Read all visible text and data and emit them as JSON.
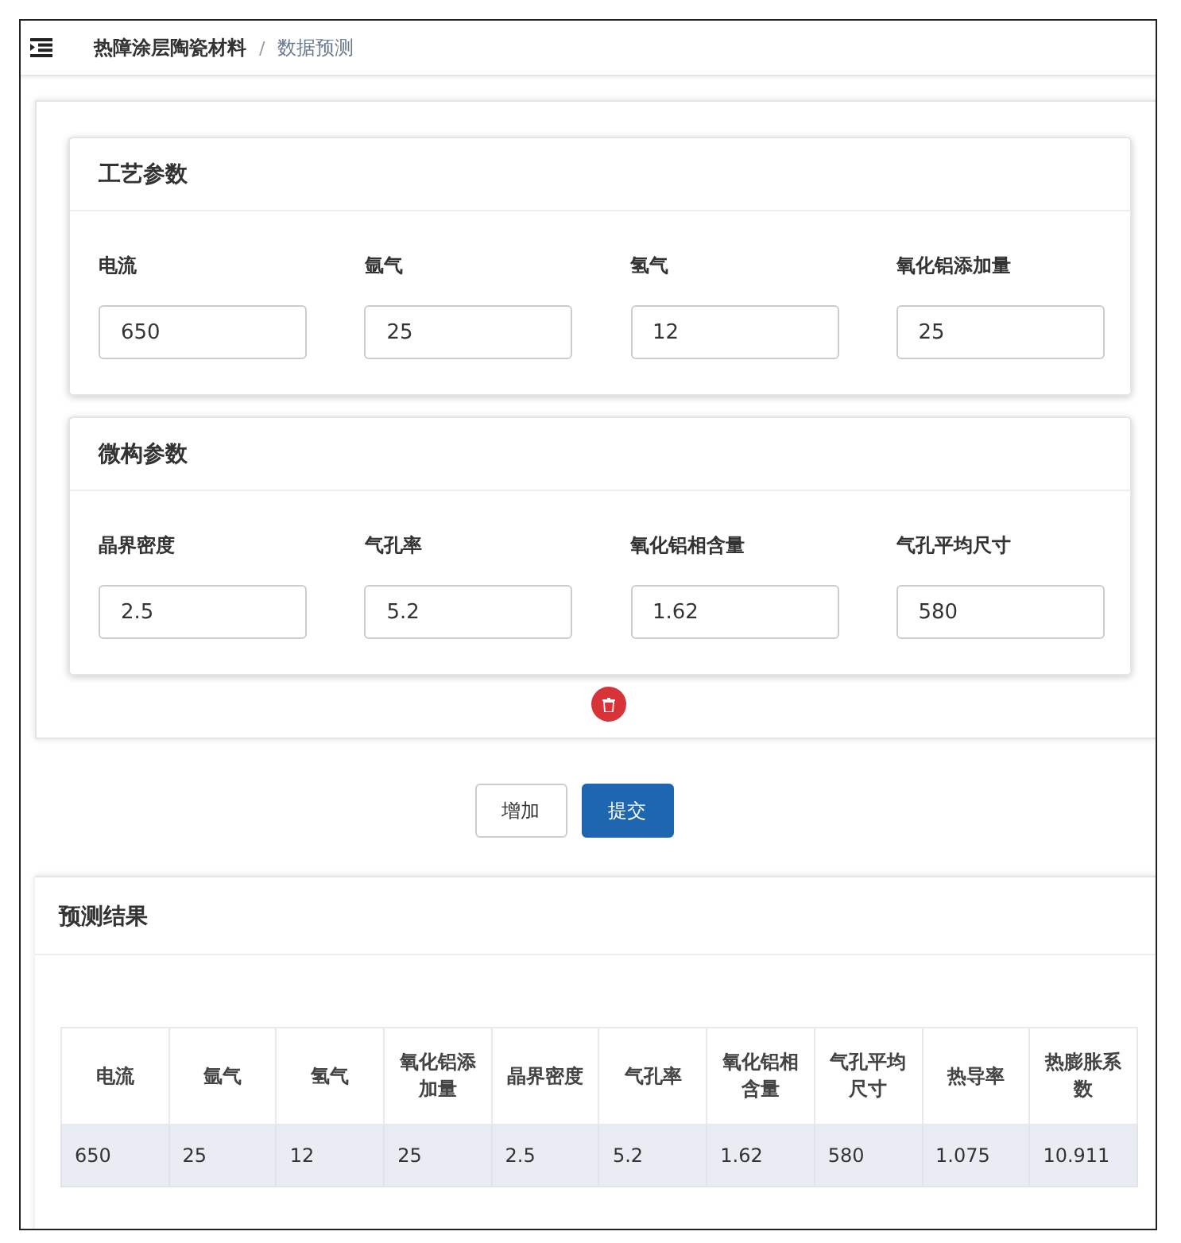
{
  "breadcrumb": {
    "separator": "/",
    "items": [
      "热障涂层陶瓷材料",
      "数据预测"
    ]
  },
  "sections": [
    {
      "title": "工艺参数",
      "fields": [
        {
          "label": "电流",
          "value": "650"
        },
        {
          "label": "氩气",
          "value": "25"
        },
        {
          "label": "氢气",
          "value": "12"
        },
        {
          "label": "氧化铝添加量",
          "value": "25"
        }
      ]
    },
    {
      "title": "微构参数",
      "fields": [
        {
          "label": "晶界密度",
          "value": "2.5"
        },
        {
          "label": "气孔率",
          "value": "5.2"
        },
        {
          "label": "氧化铝相含量",
          "value": "1.62"
        },
        {
          "label": "气孔平均尺寸",
          "value": "580"
        }
      ]
    }
  ],
  "buttons": [
    {
      "label": "增加",
      "kind": "default"
    },
    {
      "label": "提交",
      "kind": "primary"
    }
  ],
  "result": {
    "title": "预测结果",
    "columns": [
      "电流",
      "氩气",
      "氢气",
      "氧化铝添加量",
      "晶界密度",
      "气孔率",
      "氧化铝相含量",
      "气孔平均尺寸",
      "热导率",
      "热膨胀系数"
    ],
    "rows": [
      [
        "650",
        "25",
        "12",
        "25",
        "2.5",
        "5.2",
        "1.62",
        "580",
        "1.075",
        "10.911"
      ]
    ]
  }
}
